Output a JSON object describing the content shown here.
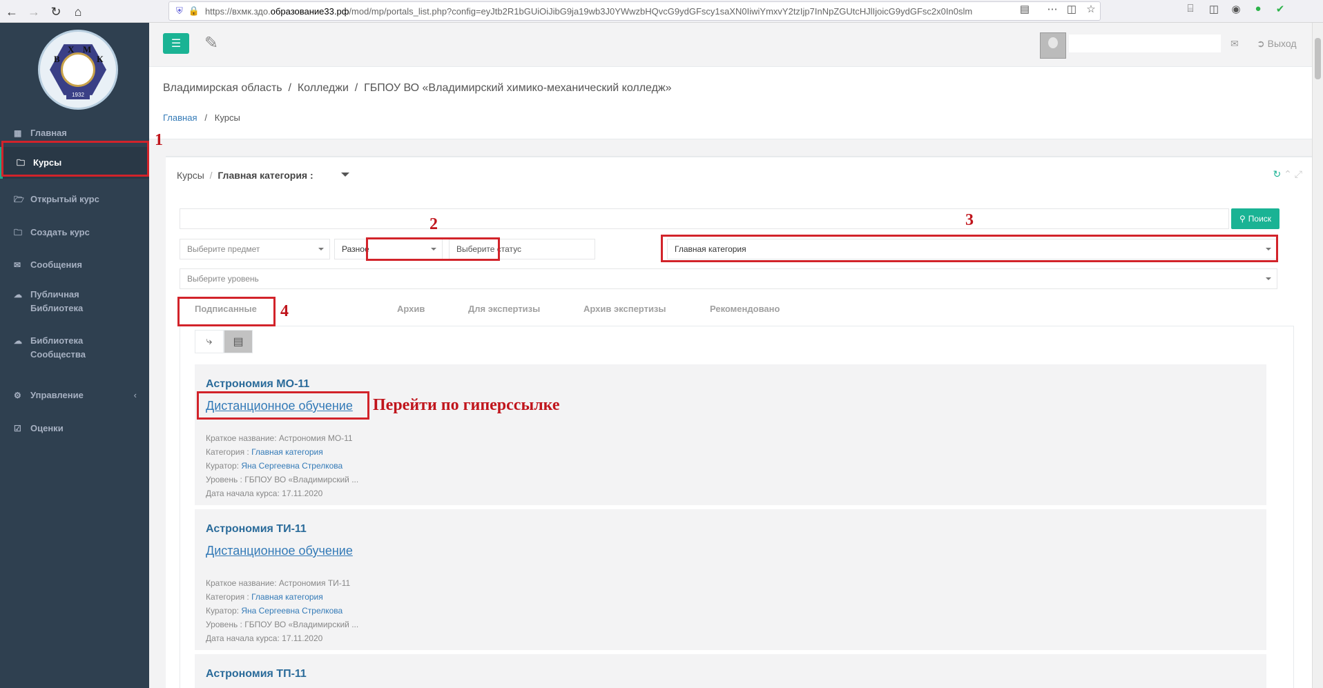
{
  "browser": {
    "url_prefix": "https://вхмк.здо.",
    "url_host": "образование33.рф",
    "url_rest": "/mod/mp/portals_list.php?config=eyJtb2R1bGUiOiJibG9ja19wb3J0YWwzbHQvcG9ydGFscy1saXN0IiwiYmxvY2tzIjp7InNpZGUtcHJlIjoicG9ydGFsc2x0In0slm"
  },
  "sidebar": {
    "logo_letters": [
      "В",
      "Х",
      "М",
      "К"
    ],
    "logo_year": "1932",
    "items": [
      {
        "label": "Главная",
        "icon": "th-large-icon"
      },
      {
        "label": "Курсы",
        "icon": "folder-icon"
      },
      {
        "label": "Открытый курс",
        "icon": "folder-open-icon"
      },
      {
        "label": "Создать курс",
        "icon": "folder-plus-icon"
      },
      {
        "label": "Сообщения",
        "icon": "envelope-icon"
      },
      {
        "label": "Публичная Библиотека",
        "icon": "cloud-icon"
      },
      {
        "label": "Библиотека Сообщества",
        "icon": "cloud-icon"
      },
      {
        "label": "Управление",
        "icon": "cogs-icon"
      },
      {
        "label": "Оценки",
        "icon": "check-square-icon"
      }
    ]
  },
  "header": {
    "logout_label": "Выход"
  },
  "page": {
    "breadcrumb_main": "Владимирская область  /  Колледжи  /  ГБПОУ ВО «Владимирский химико-механический колледж»",
    "breadcrumb_home": "Главная",
    "breadcrumb_current": "Курсы"
  },
  "ibox": {
    "title_prefix": "Курсы",
    "title_current": "Главная категория :"
  },
  "filters": {
    "search_label": "Поиск",
    "subject_placeholder": "Выберите предмет",
    "type_value": "Разное",
    "status_placeholder": "Выберите статус",
    "category_value": "Главная категория",
    "level_placeholder": "Выберите уровень"
  },
  "tabs": [
    "Подписанные",
    "Архив",
    "Для экспертизы",
    "Архив экспертизы",
    "Рекомендовано"
  ],
  "courses": [
    {
      "title": "Астрономия МО-11",
      "link": "Дистанционное обучение",
      "short_label": "Краткое название: Астрономия МО-11",
      "category_label": "Категория : ",
      "category_value": "Главная категория",
      "curator_label": "Куратор: ",
      "curator_value": "Яна Сергеевна Стрелкова",
      "level": "Уровень : ГБПОУ ВО «Владимирский ...",
      "start": "Дата начала курса: 17.11.2020"
    },
    {
      "title": "Астрономия ТИ-11",
      "link": "Дистанционное обучение",
      "short_label": "Краткое название: Астрономия ТИ-11",
      "category_label": "Категория : ",
      "category_value": "Главная категория",
      "curator_label": "Куратор: ",
      "curator_value": "Яна Сергеевна Стрелкова",
      "level": "Уровень : ГБПОУ ВО «Владимирский ...",
      "start": "Дата начала курса: 17.11.2020"
    },
    {
      "title": "Астрономия ТП-11"
    }
  ],
  "annotations": {
    "n1": "1",
    "n2": "2",
    "n3": "3",
    "n4": "4",
    "hint": "Перейти по гиперссылке",
    "color": "#d2232a"
  }
}
